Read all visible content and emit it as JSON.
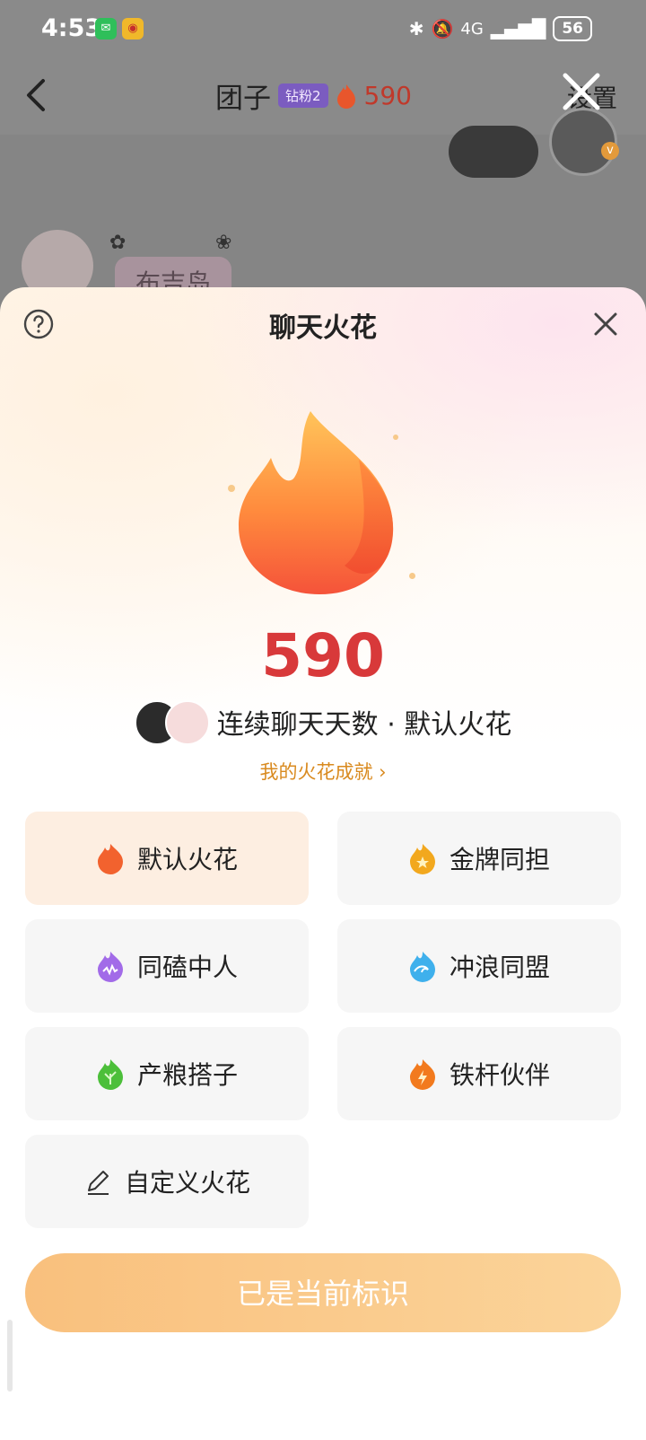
{
  "status_bar": {
    "time": "4:53",
    "network": "4G",
    "battery": "56",
    "apps": [
      "wechat-icon",
      "weibo-icon"
    ]
  },
  "chat_header": {
    "title": "团子",
    "badge": "钻粉2",
    "streak": "590",
    "settings": "设置"
  },
  "chat_preview": {
    "message": "布吉岛"
  },
  "sheet": {
    "title": "聊天火花",
    "streak_count": "590",
    "streak_label": "连续聊天天数 · 默认火花",
    "achievement_link": "我的火花成就 ›",
    "options": [
      {
        "label": "默认火花",
        "icon": "flame-orange-icon",
        "selected": true
      },
      {
        "label": "金牌同担",
        "icon": "flame-gold-star-icon",
        "selected": false
      },
      {
        "label": "同磕中人",
        "icon": "flame-purple-icon",
        "selected": false
      },
      {
        "label": "冲浪同盟",
        "icon": "flame-blue-wave-icon",
        "selected": false
      },
      {
        "label": "产粮搭子",
        "icon": "flame-green-leaf-icon",
        "selected": false
      },
      {
        "label": "铁杆伙伴",
        "icon": "flame-bolt-icon",
        "selected": false
      },
      {
        "label": "自定义火花",
        "icon": "pencil-icon",
        "selected": false
      }
    ],
    "primary_button": "已是当前标识"
  },
  "colors": {
    "accent_red": "#d8393a",
    "accent_orange": "#d98a1f",
    "button_start": "#f9c07d",
    "button_end": "#fbd49a",
    "selected_card": "#fdeee1"
  }
}
